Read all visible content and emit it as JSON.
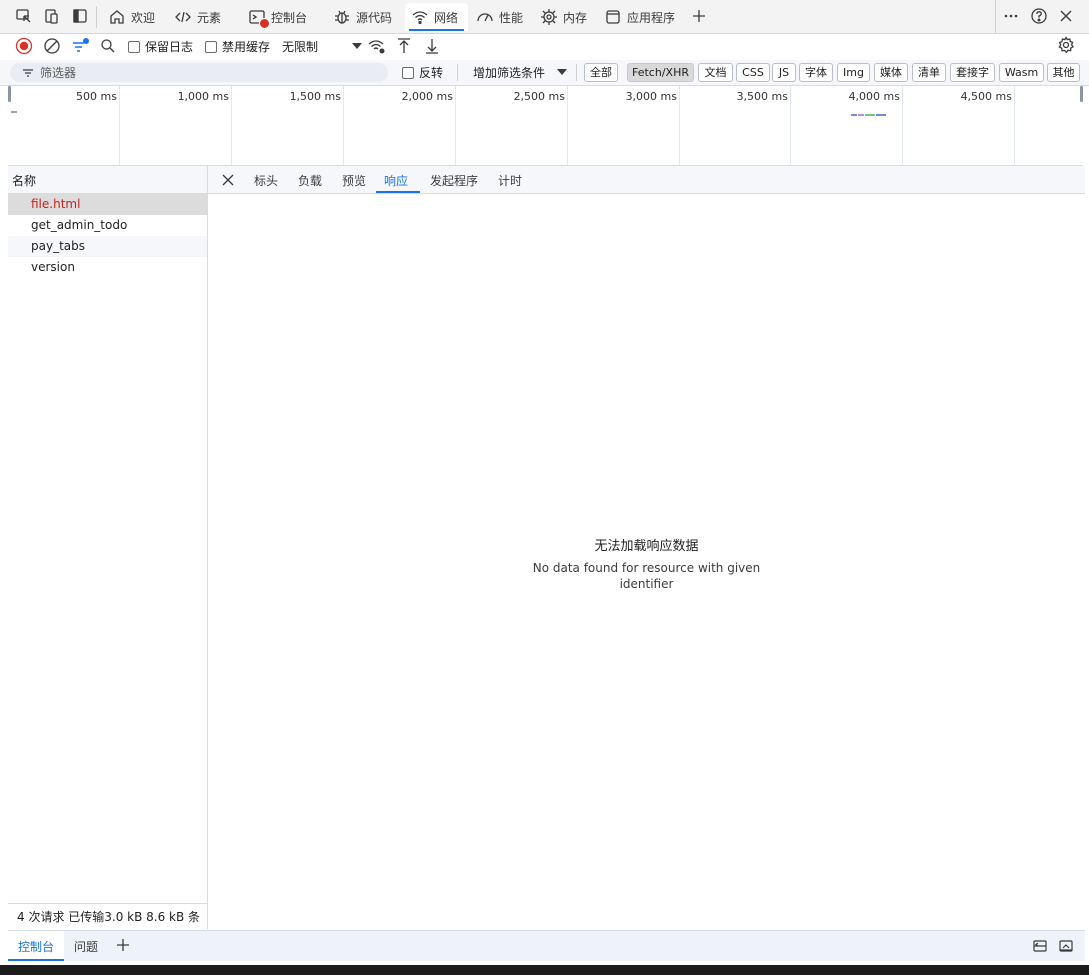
{
  "tabbar": {
    "tabs": [
      {
        "label": "欢迎",
        "icon": "home-icon"
      },
      {
        "label": "元素",
        "icon": "code-icon"
      },
      {
        "label": "控制台",
        "icon": "console-icon"
      },
      {
        "label": "源代码",
        "icon": "bug-icon"
      },
      {
        "label": "网络",
        "icon": "wifi-icon"
      },
      {
        "label": "性能",
        "icon": "gauge-icon"
      },
      {
        "label": "内存",
        "icon": "memory-chip-icon"
      },
      {
        "label": "应用程序",
        "icon": "app-icon"
      }
    ],
    "active_tab": "网络"
  },
  "toolbar": {
    "preserve_log": "保留日志",
    "disable_cache": "禁用缓存",
    "throttling": "无限制"
  },
  "filters": {
    "placeholder": "筛选器",
    "invert": "反转",
    "more_filters": "增加筛选条件",
    "types": [
      "全部",
      "Fetch/XHR",
      "文档",
      "CSS",
      "JS",
      "字体",
      "Img",
      "媒体",
      "清单",
      "套接字",
      "Wasm",
      "其他"
    ],
    "active_type": "Fetch/XHR"
  },
  "timeline": {
    "ticks": [
      "500 ms",
      "1,000 ms",
      "1,500 ms",
      "2,000 ms",
      "2,500 ms",
      "3,000 ms",
      "3,500 ms",
      "4,000 ms",
      "4,500 ms"
    ]
  },
  "requests": {
    "header": "名称",
    "items": [
      "file.html",
      "get_admin_todo",
      "pay_tabs",
      "version"
    ],
    "selected": "file.html",
    "status": "4 次请求   已传输3.0 kB   8.6 kB 条"
  },
  "detail": {
    "tabs": [
      "标头",
      "负载",
      "预览",
      "响应",
      "发起程序",
      "计时"
    ],
    "active_tab": "响应",
    "empty_title": "无法加载响应数据",
    "empty_message": "No data found for resource with given identifier"
  },
  "drawer": {
    "tabs": [
      "控制台",
      "问题"
    ],
    "active_tab": "控制台"
  },
  "colors": {
    "accent": "#1a73e8",
    "record": "#d93025",
    "selected_request_text": "#c5221f"
  }
}
